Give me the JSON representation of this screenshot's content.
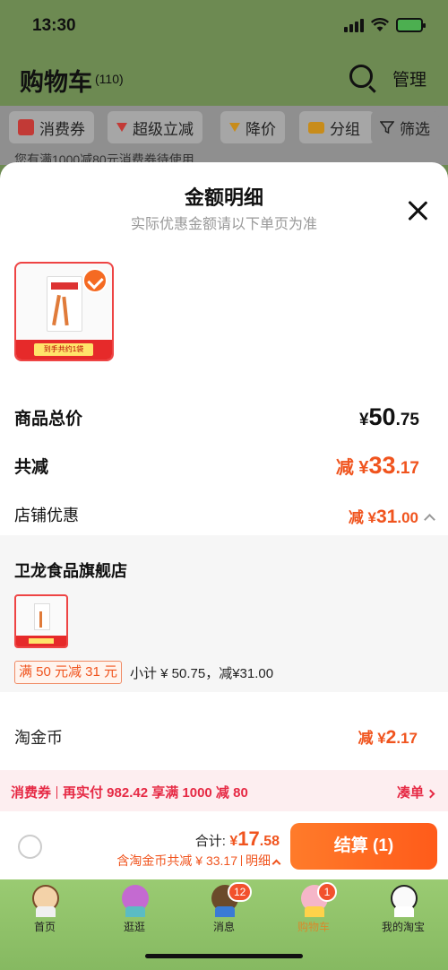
{
  "status_bar": {
    "time": "13:30"
  },
  "header": {
    "title": "购物车",
    "count": "(110)",
    "manage_label": "管理"
  },
  "filter_chips": [
    {
      "label": "消费券",
      "icon": "coupon-icon",
      "color": "#d8322e"
    },
    {
      "label": "超级立减",
      "icon": "arrow-down-icon",
      "color": "#d8322e"
    },
    {
      "label": "降价",
      "icon": "arrow-down-icon",
      "color": "#e0a020"
    },
    {
      "label": "分组",
      "icon": "folder-icon",
      "color": "#e0a020"
    },
    {
      "label": "筛选",
      "icon": "filter-icon",
      "color": "#222222"
    }
  ],
  "bg_notice": "您有满1000减80元消费券待使用",
  "sheet": {
    "title": "金额明细",
    "subtitle": "实际优惠金额请以下单页为准",
    "product_badge": "到手共约1袋",
    "total_label": "商品总价",
    "total_currency": "¥",
    "total_int": "50",
    "total_dec": ".75",
    "reduce_label": "共减",
    "reduce_prefix": "减 ¥",
    "reduce_int": "33",
    "reduce_dec": ".17",
    "shop_discount_label": "店铺优惠",
    "shop_discount_prefix": "减 ¥",
    "shop_discount_int": "31",
    "shop_discount_dec": ".00",
    "store": {
      "name": "卫龙食品旗舰店",
      "promo": "满 50 元减 31 元",
      "subtotal": "小计 ¥ 50.75，减¥31.00"
    },
    "coin_label": "淘金币",
    "coin_prefix": "减 ¥",
    "coin_int": "2",
    "coin_dec": ".17"
  },
  "coupon_bar": {
    "tag": "消费券",
    "text": "再实付 982.42 享满 1000 减 80",
    "action": "凑单"
  },
  "checkout": {
    "total_label": "合计:",
    "currency": "¥",
    "total_int": "17",
    "total_dec": ".58",
    "sub_text": "含淘金币共减 ¥ 33.17",
    "detail_label": "明细",
    "button_label": "结算 (1)"
  },
  "tabbar": {
    "items": [
      {
        "label": "首页",
        "icon": "home-icon"
      },
      {
        "label": "逛逛",
        "icon": "explore-icon"
      },
      {
        "label": "消息",
        "icon": "message-icon",
        "badge": "12"
      },
      {
        "label": "购物车",
        "icon": "cart-icon",
        "badge": "1"
      },
      {
        "label": "我的淘宝",
        "icon": "profile-icon"
      }
    ]
  },
  "colors": {
    "accent": "#f0541e",
    "coupon_red": "#e62a45",
    "tabbar_green": "#9acb72"
  }
}
